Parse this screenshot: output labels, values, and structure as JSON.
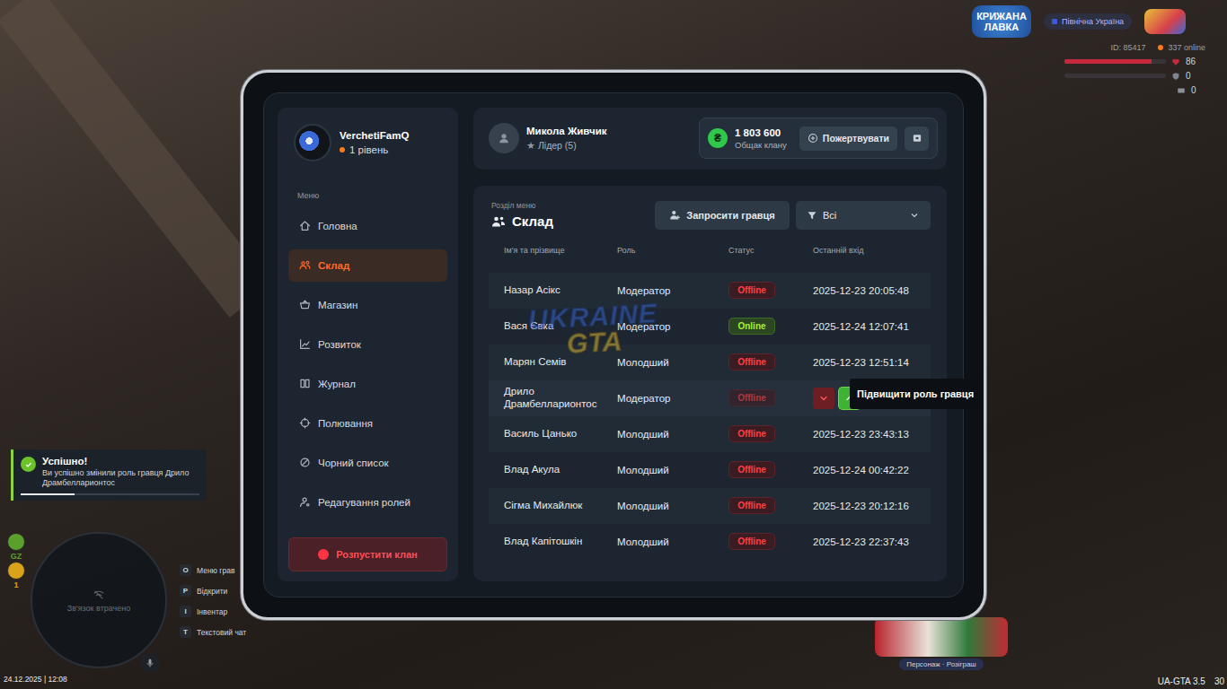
{
  "hud": {
    "server_logo": "КРИЖАНА ЛАВКА",
    "server_region": "Північна Україна",
    "player_id": "ID: 85417",
    "online_count": "337 online",
    "stats": [
      {
        "value": "86",
        "level": 0.86,
        "color": "#c8283c"
      },
      {
        "value": "0",
        "level": 0,
        "color": "#7d8590"
      }
    ],
    "money": "0",
    "zone": [
      {
        "label": "GZ",
        "color": "#5aa02c"
      },
      {
        "label": "1",
        "color": "#d9a21b"
      }
    ],
    "minimap_text": "Зв'язок втрачено",
    "keybinds": [
      {
        "key": "O",
        "label": "Меню грав"
      },
      {
        "key": "P",
        "label": "Відкрити"
      },
      {
        "key": "I",
        "label": "Інвентар"
      },
      {
        "key": "T",
        "label": "Текстовий чат"
      }
    ],
    "date": "24.12.2025 | 12:08",
    "event_banner": "Персонаж · Розіграш",
    "version": "UA-GTA 3.5",
    "fps": "30"
  },
  "notification": {
    "title": "Успішно!",
    "message": "Ви успішно змінили роль гравця Дрило Драмбелларионтос",
    "level": 0.3
  },
  "tablet": {
    "clan": {
      "name": "VerchetiFamQ",
      "level": "1 рівень"
    },
    "sidebar": {
      "heading": "Меню",
      "items": [
        {
          "label": "Головна",
          "selected": false
        },
        {
          "label": "Склад",
          "selected": true
        },
        {
          "label": "Магазин",
          "selected": false
        },
        {
          "label": "Розвиток",
          "selected": false
        },
        {
          "label": "Журнал",
          "selected": false
        },
        {
          "label": "Полювання",
          "selected": false
        },
        {
          "label": "Чорний список",
          "selected": false
        },
        {
          "label": "Редагування ролей",
          "selected": false
        }
      ],
      "disband_button": "Розпустити клан"
    },
    "user": {
      "name": "Микола Живчик",
      "rank_icon": "★",
      "rank": "Лідер (5)"
    },
    "treasury": {
      "coin": "₴",
      "amount": "1 803 600",
      "label": "Общак клану",
      "donate_button": "Пожертвувати"
    },
    "section": {
      "caption": "Розділ меню",
      "title": "Склад"
    },
    "invite_button": "Запросити гравця",
    "filter": {
      "label": "Всі"
    },
    "table": {
      "columns": [
        "Ім'я та прізвище",
        "Роль",
        "Статус",
        "Останній вхід"
      ],
      "rows": [
        {
          "name": "Назар Асікс",
          "role": "Модератор",
          "status": "Offline",
          "online": false,
          "last_login": "2025-12-23 20:05:48",
          "hovered": false
        },
        {
          "name": "Вася Євка",
          "role": "Модератор",
          "status": "Online",
          "online": true,
          "last_login": "2025-12-24 12:07:41",
          "hovered": false
        },
        {
          "name": "Марян Семів",
          "role": "Молодший",
          "status": "Offline",
          "online": false,
          "last_login": "2025-12-23 12:51:14",
          "hovered": false
        },
        {
          "name": "Дрило Драмбелларионтос",
          "role": "Модератор",
          "status": "Offline",
          "online": false,
          "hovered": true,
          "actions": [
            {
              "kind": "demote",
              "selected": false
            },
            {
              "kind": "promote",
              "selected": true
            },
            {
              "kind": "user-settings",
              "selected": false
            },
            {
              "kind": "user-remove",
              "selected": false
            }
          ]
        },
        {
          "name": "Василь Цанько",
          "role": "Молодший",
          "status": "Offline",
          "online": false,
          "last_login": "2025-12-23 23:43:13",
          "hovered": false
        },
        {
          "name": "Влад Акула",
          "role": "Молодший",
          "status": "Offline",
          "online": false,
          "last_login": "2025-12-24 00:42:22",
          "hovered": false
        },
        {
          "name": "Сігма Михайлюк",
          "role": "Молодший",
          "status": "Offline",
          "online": false,
          "last_login": "2025-12-23 20:12:16",
          "hovered": false
        },
        {
          "name": "Влад Капітошкін",
          "role": "Молодший",
          "status": "Offline",
          "online": false,
          "last_login": "2025-12-23 22:37:43",
          "hovered": false
        }
      ]
    },
    "tooltip": "Підвищити роль гравця",
    "watermark": {
      "top": "UKRAINE",
      "bottom": "GTA"
    }
  }
}
